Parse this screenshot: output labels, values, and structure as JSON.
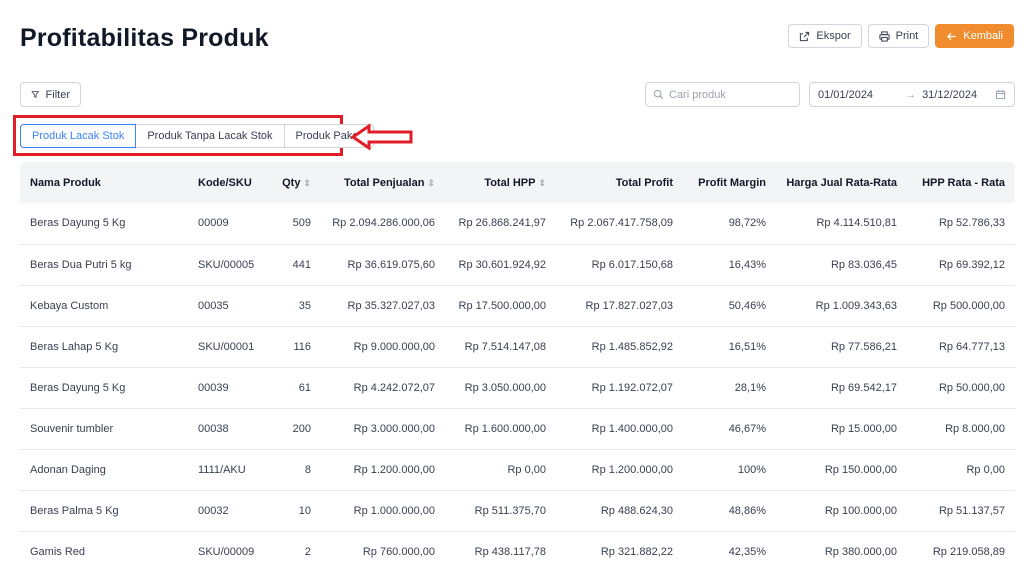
{
  "header": {
    "title": "Profitabilitas Produk"
  },
  "actions": {
    "export_label": "Ekspor",
    "print_label": "Print",
    "back_label": "Kembali"
  },
  "filter": {
    "label": "Filter"
  },
  "search": {
    "placeholder": "Cari produk"
  },
  "date_range": {
    "start": "01/01/2024",
    "end": "31/12/2024"
  },
  "tabs": [
    {
      "label": "Produk Lacak Stok",
      "active": true
    },
    {
      "label": "Produk Tanpa Lacak Stok",
      "active": false
    },
    {
      "label": "Produk Paket",
      "active": false
    }
  ],
  "colors": {
    "accent": "#f08c2e",
    "active_tab": "#3b82f6",
    "annotation": "#e11d2a"
  },
  "table": {
    "columns": [
      {
        "label": "Nama Produk",
        "sortable": false
      },
      {
        "label": "Kode/SKU",
        "sortable": false
      },
      {
        "label": "Qty",
        "sortable": true
      },
      {
        "label": "Total Penjualan",
        "sortable": true
      },
      {
        "label": "Total HPP",
        "sortable": true
      },
      {
        "label": "Total Profit",
        "sortable": false
      },
      {
        "label": "Profit Margin",
        "sortable": false
      },
      {
        "label": "Harga Jual Rata-Rata",
        "sortable": false
      },
      {
        "label": "HPP Rata - Rata",
        "sortable": false
      }
    ],
    "rows": [
      [
        "Beras Dayung 5 Kg",
        "00009",
        "509",
        "Rp 2.094.286.000,06",
        "Rp 26.868.241,97",
        "Rp 2.067.417.758,09",
        "98,72%",
        "Rp 4.114.510,81",
        "Rp 52.786,33"
      ],
      [
        "Beras Dua Putri 5 kg",
        "SKU/00005",
        "441",
        "Rp 36.619.075,60",
        "Rp 30.601.924,92",
        "Rp 6.017.150,68",
        "16,43%",
        "Rp 83.036,45",
        "Rp 69.392,12"
      ],
      [
        "Kebaya Custom",
        "00035",
        "35",
        "Rp 35.327.027,03",
        "Rp 17.500.000,00",
        "Rp 17.827.027,03",
        "50,46%",
        "Rp 1.009.343,63",
        "Rp 500.000,00"
      ],
      [
        "Beras Lahap 5 Kg",
        "SKU/00001",
        "116",
        "Rp 9.000.000,00",
        "Rp 7.514.147,08",
        "Rp 1.485.852,92",
        "16,51%",
        "Rp 77.586,21",
        "Rp 64.777,13"
      ],
      [
        "Beras Dayung 5 Kg",
        "00039",
        "61",
        "Rp 4.242.072,07",
        "Rp 3.050.000,00",
        "Rp 1.192.072,07",
        "28,1%",
        "Rp 69.542,17",
        "Rp 50.000,00"
      ],
      [
        "Souvenir tumbler",
        "00038",
        "200",
        "Rp 3.000.000,00",
        "Rp 1.600.000,00",
        "Rp 1.400.000,00",
        "46,67%",
        "Rp 15.000,00",
        "Rp 8.000,00"
      ],
      [
        "Adonan Daging",
        "1111/AKU",
        "8",
        "Rp 1.200.000,00",
        "Rp 0,00",
        "Rp 1.200.000,00",
        "100%",
        "Rp 150.000,00",
        "Rp 0,00"
      ],
      [
        "Beras Palma 5 Kg",
        "00032",
        "10",
        "Rp 1.000.000,00",
        "Rp 511.375,70",
        "Rp 488.624,30",
        "48,86%",
        "Rp 100.000,00",
        "Rp 51.137,57"
      ],
      [
        "Gamis Red",
        "SKU/00009",
        "2",
        "Rp 760.000,00",
        "Rp 438.117,78",
        "Rp 321.882,22",
        "42,35%",
        "Rp 380.000,00",
        "Rp 219.058,89"
      ]
    ]
  }
}
